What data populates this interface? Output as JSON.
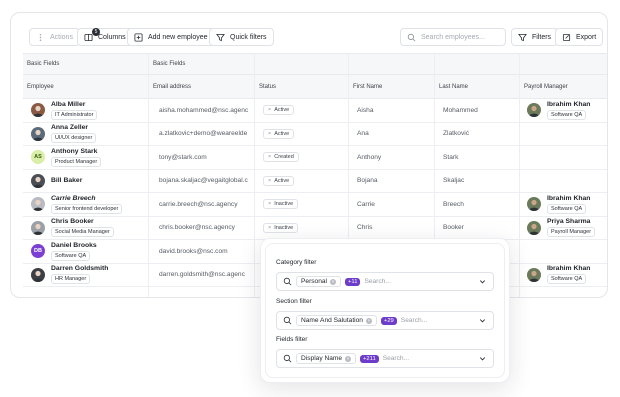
{
  "toolbar": {
    "actions_label": "Actions",
    "columns_label": "Columns",
    "columns_count": "5",
    "add_label": "Add new employee",
    "quick_filters_label": "Quick filters",
    "search_placeholder": "Search employees...",
    "filters_label": "Filters",
    "export_label": "Export"
  },
  "table": {
    "groups": [
      "Basic Fields",
      "Basic Fields"
    ],
    "columns": [
      "Employee",
      "Email address",
      "Status",
      "First Name",
      "Last Name",
      "Payroll Manager"
    ],
    "rows": [
      {
        "name": "Alba Miller",
        "role": "IT Administrator",
        "initials": "",
        "email": "aisha.mohammed@nsc.agenc",
        "status": "Active",
        "first": "Aisha",
        "last": "Mohammed",
        "mgr_name": "Ibrahim Khan",
        "mgr_role": "Software QA"
      },
      {
        "name": "Anna Zeller",
        "role": "UI/UX designer",
        "initials": "",
        "email": "a.zlatkovic+demo@weareelde",
        "status": "Active",
        "first": "Ana",
        "last": "Zlatković",
        "mgr_name": "",
        "mgr_role": ""
      },
      {
        "name": "Anthony Stark",
        "role": "Product Manager",
        "initials": "AS",
        "email": "tony@stark.com",
        "status": "Created",
        "first": "Anthony",
        "last": "Stark",
        "mgr_name": "",
        "mgr_role": ""
      },
      {
        "name": "Bill Baker",
        "role": "",
        "initials": "",
        "email": "bojana.skaljac@vegaitglobal.c",
        "status": "Active",
        "first": "Bojana",
        "last": "Skaljac",
        "mgr_name": "",
        "mgr_role": ""
      },
      {
        "name": "Carrie Breech",
        "role": "Senior frontend developer",
        "initials": "",
        "email": "carrie.breech@nsc.agency",
        "status": "Inactive",
        "first": "Carrie",
        "last": "Breech",
        "mgr_name": "Ibrahim Khan",
        "mgr_role": "Software QA"
      },
      {
        "name": "Chris Booker",
        "role": "Social Media Manager",
        "initials": "",
        "email": "chris.booker@nsc.agency",
        "status": "Inactive",
        "first": "Chris",
        "last": "Booker",
        "mgr_name": "Priya Sharma",
        "mgr_role": "Payroll Manager"
      },
      {
        "name": "Daniel Brooks",
        "role": "Software QA",
        "initials": "DB",
        "email": "david.brooks@nsc.com",
        "status": "",
        "first": "",
        "last": "",
        "mgr_name": "",
        "mgr_role": ""
      },
      {
        "name": "Darren Goldsmith",
        "role": "HR Manager",
        "initials": "",
        "email": "darren.goldsmith@nsc.agenc",
        "status": "",
        "first": "",
        "last": "",
        "mgr_name": "Ibrahim Khan",
        "mgr_role": "Software QA"
      }
    ]
  },
  "filters": {
    "category": {
      "label": "Category filter",
      "chip": "Personal",
      "more": "+11",
      "placeholder": "Search..."
    },
    "section": {
      "label": "Section filter",
      "chip": "Name And Salutation",
      "more": "+29",
      "placeholder": "Search..."
    },
    "fields": {
      "label": "Fields filter",
      "chip": "Display Name",
      "more": "+211",
      "placeholder": "Search..."
    }
  },
  "colors": {
    "accent": "#6d3cc9",
    "border": "#dfe2e6"
  }
}
